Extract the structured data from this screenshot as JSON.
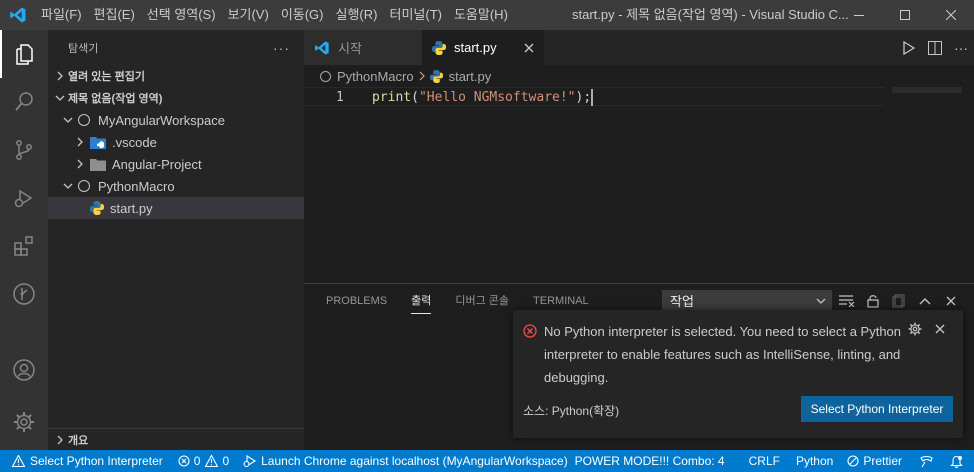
{
  "titlebar": {
    "menu": [
      "파일(F)",
      "편집(E)",
      "선택 영역(S)",
      "보기(V)",
      "이동(G)",
      "실행(R)",
      "터미널(T)",
      "도움말(H)"
    ],
    "title": "start.py - 제목 없음(작업 영역) - Visual Studio C..."
  },
  "sidebar": {
    "header": "탐색기",
    "more": "···",
    "open_editors": "열려 있는 편집기",
    "workspace": "제목 없음(작업 영역)",
    "tree": [
      {
        "label": "MyAngularWorkspace"
      },
      {
        "label": ".vscode"
      },
      {
        "label": "Angular-Project"
      },
      {
        "label": "PythonMacro"
      },
      {
        "label": "start.py"
      }
    ],
    "outline": "개요"
  },
  "tabs": [
    {
      "label": "시작"
    },
    {
      "label": "start.py"
    }
  ],
  "breadcrumb": [
    "PythonMacro",
    "start.py"
  ],
  "editor": {
    "line_number": "1",
    "code_fn": "print",
    "code_open": "(",
    "code_string": "\"Hello NGMsoftware!\"",
    "code_close": ");"
  },
  "panel": {
    "tabs": [
      "PROBLEMS",
      "출력",
      "디버그 콘솔",
      "TERMINAL"
    ],
    "active_tab": "출력",
    "select_value": "작업"
  },
  "notification": {
    "message": "No Python interpreter is selected. You need to select a Python interpreter to enable features such as IntelliSense, linting, and debugging.",
    "source": "소스: Python(확장)",
    "button": "Select Python Interpreter"
  },
  "statusbar": {
    "interpreter": "Select Python Interpreter",
    "errors": "0",
    "warnings": "0",
    "launch": "Launch Chrome against localhost (MyAngularWorkspace)",
    "power_mode": "POWER MODE!!! Combo: 4",
    "eol": "CRLF",
    "language": "Python",
    "prettier": "Prettier"
  },
  "colors": {
    "accent": "#007acc",
    "button": "#0e639c",
    "error": "#f14c4c",
    "python_blue": "#3572a5",
    "python_yellow": "#ffd43b"
  }
}
